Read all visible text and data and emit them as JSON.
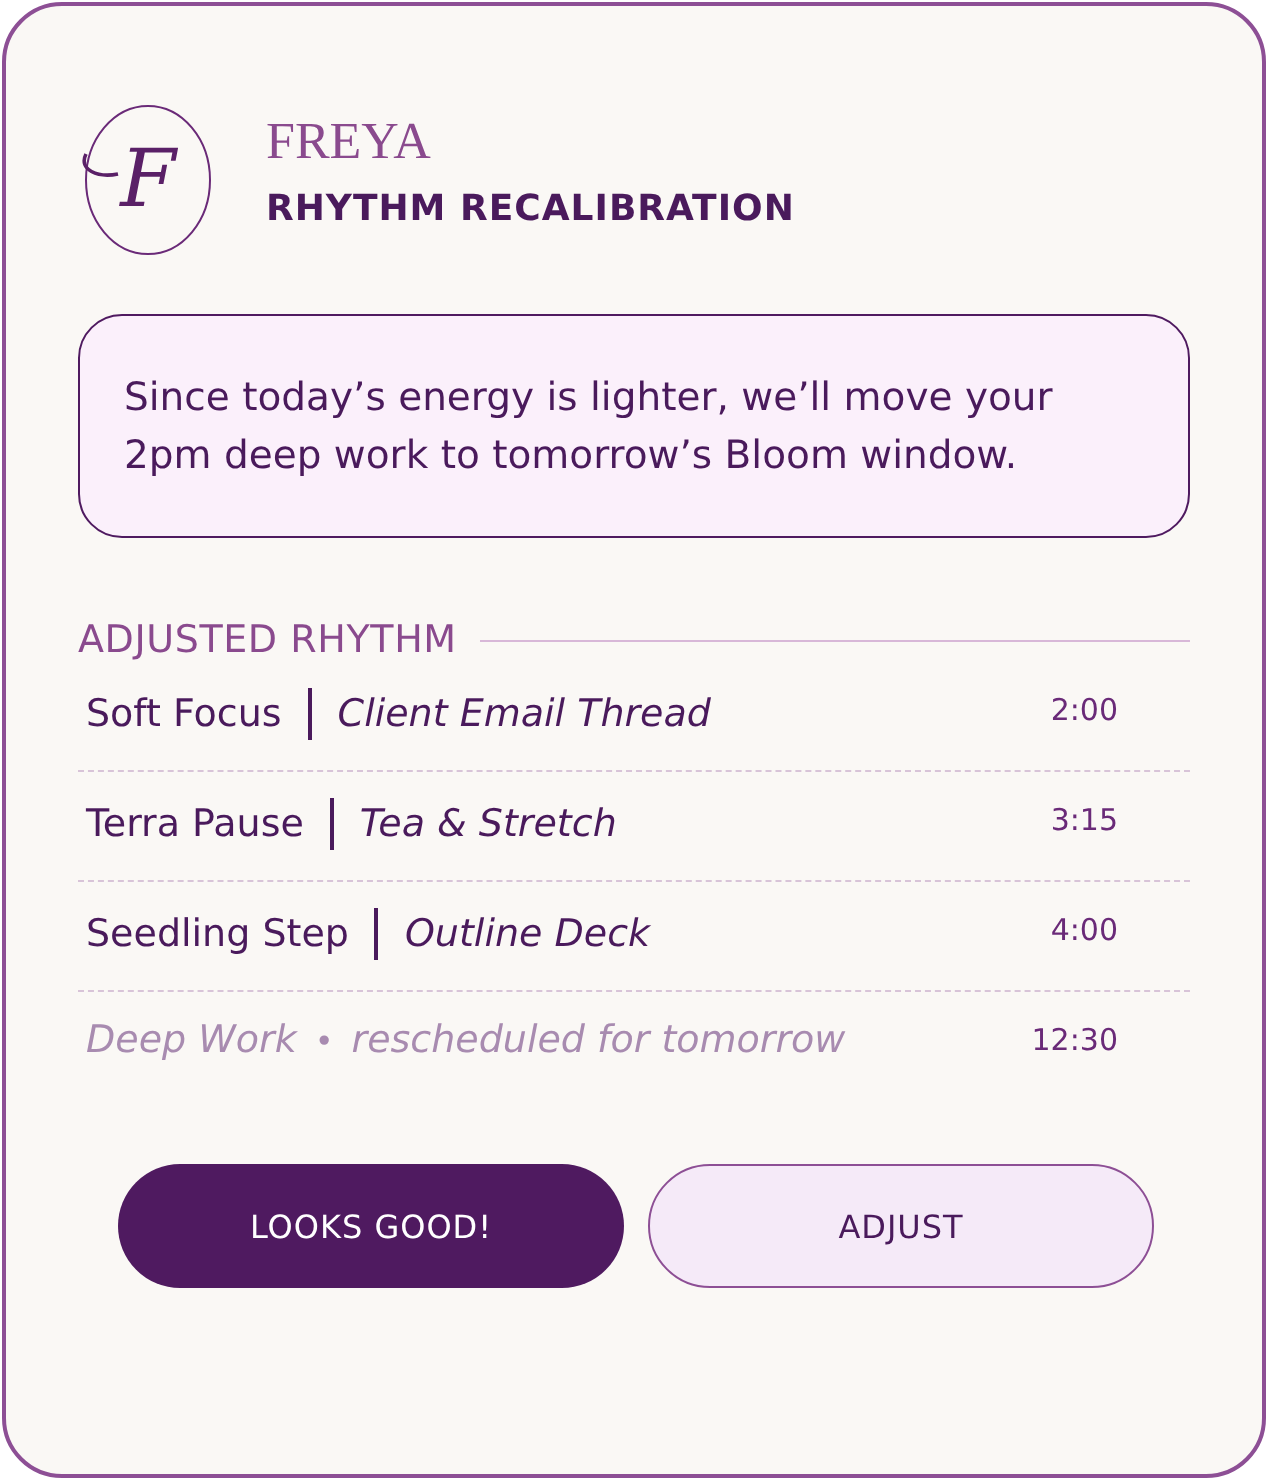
{
  "header": {
    "logo_letter": "F",
    "brand": "FREYA",
    "title": "RHYTHM RECALIBRATION"
  },
  "message": "Since today’s energy is lighter, we’ll move your 2pm deep work to tomorrow’s Bloom window.",
  "section_heading": "ADJUSTED RHYTHM",
  "rows": [
    {
      "kind": "task",
      "title": "Soft Focus",
      "detail": "Client Email Thread",
      "time": "2:00"
    },
    {
      "kind": "task",
      "title": "Terra Pause",
      "detail": "Tea & Stretch",
      "time": "3:15"
    },
    {
      "kind": "task",
      "title": "Seedling Step",
      "detail": "Outline Deck",
      "time": "4:00"
    },
    {
      "kind": "rescheduled",
      "title": "Deep Work",
      "separator": "•",
      "detail": "rescheduled for tomorrow",
      "time": "12:30"
    }
  ],
  "buttons": [
    {
      "label": "LOOKS GOOD!",
      "kind": "primary"
    },
    {
      "label": "ADJUST",
      "kind": "secondary"
    }
  ]
}
